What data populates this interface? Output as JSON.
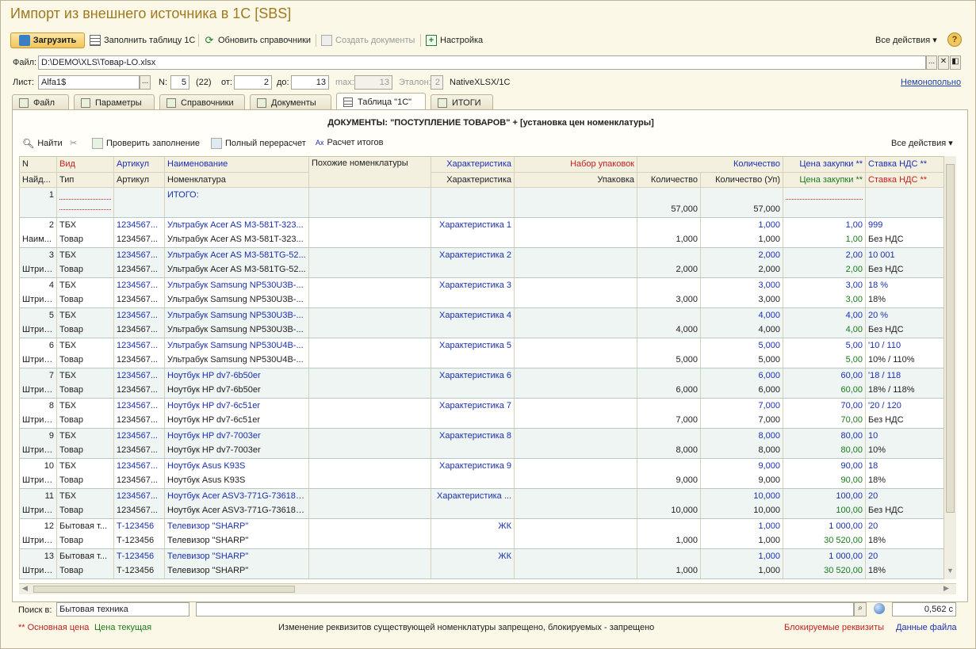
{
  "window": {
    "title": "Импорт из внешнего источника в 1С [SBS]"
  },
  "toolbar": {
    "load_label": "Загрузить",
    "fill_table_label": "Заполнить таблицу 1С",
    "refresh_refs_label": "Обновить справочники",
    "create_docs_label": "Создать документы",
    "settings_label": "Настройка",
    "all_actions_label": "Все действия ▾",
    "help_label": "?"
  },
  "file": {
    "label": "Файл:",
    "value": "D:\\DEMO\\XLS\\Товар-LO.xlsx",
    "btn_browse": "...",
    "btn_clear": "✕",
    "btn_open": "◧"
  },
  "params": {
    "sheet_label": "Лист:",
    "sheet_value": "Alfa1$",
    "sheet_btn": "...",
    "num_label": "N:",
    "num_value": "5",
    "num_total": "(22)",
    "from_label": "от:",
    "from_value": "2",
    "to_label": "до:",
    "to_value": "13",
    "max_label": "max:",
    "max_value": "13",
    "etalon_label": "Эталон:",
    "etalon_value": "2",
    "format_label": "NativeXLSX/1C",
    "mode_link": "Немонопольно"
  },
  "tabs": [
    {
      "label": "Файл"
    },
    {
      "label": "Параметры"
    },
    {
      "label": "Справочники"
    },
    {
      "label": "Документы"
    },
    {
      "label": "Таблица \"1С\""
    },
    {
      "label": "ИТОГИ"
    }
  ],
  "panel": {
    "title": "ДОКУМЕНТЫ: \"ПОСТУПЛЕНИЕ ТОВАРОВ\" + [установка цен номенклатуры]",
    "find_label": "Найти",
    "check_label": "Проверить заполнение",
    "recalc_label": "Полный перерасчет",
    "totals_label": "Расчет итогов",
    "all_actions_label": "Все действия ▾"
  },
  "table": {
    "header1": [
      "N",
      "Вид",
      "Артикул",
      "Наименование",
      "Похожие номенклатуры",
      "Характеристика",
      "Набор упаковок",
      "",
      "Количество",
      "Цена закупки **",
      "Ставка НДС **"
    ],
    "header2": [
      "Найд...",
      "Тип",
      "Артикул",
      "Номенклатура",
      "",
      "Характеристика",
      "Упаковка",
      "Количество",
      "Количество (Уп)",
      "Цена закупки **",
      "Ставка НДС **"
    ],
    "total_row": {
      "n": "1",
      "name": "ИТОГО:",
      "qty": "57,000",
      "qty_up": "57,000"
    },
    "rows": [
      {
        "n": "2",
        "n2": "Наим...",
        "vid": "ТБХ",
        "tip": "Товар",
        "art": "1234567...",
        "art2": "1234567...",
        "name": "Ультрабук Acer AS M3-581T-323...",
        "nom": "Ультрабук Acer AS M3-581T-323...",
        "char": "Характеристика 1",
        "qty_a": "1,000",
        "qty_b": "1,000",
        "qty_c": "1,000",
        "price_a": "1,00",
        "price_b": "1,00",
        "vat_a": "999",
        "vat_b": "Без НДС"
      },
      {
        "n": "3",
        "n2": "Штрих...",
        "vid": "ТБХ",
        "tip": "Товар",
        "art": "1234567...",
        "art2": "1234567...",
        "name": "Ультрабук Acer AS M3-581TG-52...",
        "nom": "Ультрабук Acer AS M3-581TG-52...",
        "char": "Характеристика 2",
        "qty_a": "2,000",
        "qty_b": "2,000",
        "qty_c": "2,000",
        "price_a": "2,00",
        "price_b": "2,00",
        "vat_a": "10 001",
        "vat_b": "Без НДС"
      },
      {
        "n": "4",
        "n2": "Штрих...",
        "vid": "ТБХ",
        "tip": "Товар",
        "art": "1234567...",
        "art2": "1234567...",
        "name": "Ультрабук Samsung NP530U3B-...",
        "nom": "Ультрабук Samsung NP530U3B-...",
        "char": "Характеристика 3",
        "qty_a": "3,000",
        "qty_b": "3,000",
        "qty_c": "3,000",
        "price_a": "3,00",
        "price_b": "3,00",
        "vat_a": "18 %",
        "vat_b": "18%"
      },
      {
        "n": "5",
        "n2": "Штрих...",
        "vid": "ТБХ",
        "tip": "Товар",
        "art": "1234567...",
        "art2": "1234567...",
        "name": "Ультрабук Samsung NP530U3B-...",
        "nom": "Ультрабук Samsung NP530U3B-...",
        "char": "Характеристика 4",
        "qty_a": "4,000",
        "qty_b": "4,000",
        "qty_c": "4,000",
        "price_a": "4,00",
        "price_b": "4,00",
        "vat_a": "20 %",
        "vat_b": "Без НДС"
      },
      {
        "n": "6",
        "n2": "Штрих...",
        "vid": "ТБХ",
        "tip": "Товар",
        "art": "1234567...",
        "art2": "1234567...",
        "name": "Ультрабук Samsung NP530U4B-...",
        "nom": "Ультрабук Samsung NP530U4B-...",
        "char": "Характеристика 5",
        "qty_a": "5,000",
        "qty_b": "5,000",
        "qty_c": "5,000",
        "price_a": "5,00",
        "price_b": "5,00",
        "vat_a": "'10 / 110",
        "vat_b": "10% / 110%"
      },
      {
        "n": "7",
        "n2": "Штрих...",
        "vid": "ТБХ",
        "tip": "Товар",
        "art": "1234567...",
        "art2": "1234567...",
        "name": "Ноутбук HP dv7-6b50er",
        "nom": "Ноутбук HP dv7-6b50er",
        "char": "Характеристика 6",
        "qty_a": "6,000",
        "qty_b": "6,000",
        "qty_c": "6,000",
        "price_a": "60,00",
        "price_b": "60,00",
        "vat_a": "'18 / 118",
        "vat_b": "18% / 118%"
      },
      {
        "n": "8",
        "n2": "Штрих...",
        "vid": "ТБХ",
        "tip": "Товар",
        "art": "1234567...",
        "art2": "1234567...",
        "name": "Ноутбук HP dv7-6c51er",
        "nom": "Ноутбук HP dv7-6c51er",
        "char": "Характеристика 7",
        "qty_a": "7,000",
        "qty_b": "7,000",
        "qty_c": "7,000",
        "price_a": "70,00",
        "price_b": "70,00",
        "vat_a": "'20 / 120",
        "vat_b": "Без НДС"
      },
      {
        "n": "9",
        "n2": "Штрих...",
        "vid": "ТБХ",
        "tip": "Товар",
        "art": "1234567...",
        "art2": "1234567...",
        "name": "Ноутбук HP dv7-7003er",
        "nom": "Ноутбук HP dv7-7003er",
        "char": "Характеристика 8",
        "qty_a": "8,000",
        "qty_b": "8,000",
        "qty_c": "8,000",
        "price_a": "80,00",
        "price_b": "80,00",
        "vat_a": "10",
        "vat_b": "10%"
      },
      {
        "n": "10",
        "n2": "Штрих...",
        "vid": "ТБХ",
        "tip": "Товар",
        "art": "1234567...",
        "art2": "1234567...",
        "name": "Ноутбук Asus K93S",
        "nom": "Ноутбук Asus K93S",
        "char": "Характеристика 9",
        "qty_a": "9,000",
        "qty_b": "9,000",
        "qty_c": "9,000",
        "price_a": "90,00",
        "price_b": "90,00",
        "vat_a": "18",
        "vat_b": "18%"
      },
      {
        "n": "11",
        "n2": "Штрих...",
        "vid": "ТБХ",
        "tip": "Товар",
        "art": "1234567...",
        "art2": "1234567...",
        "name": "Ноутбук Acer ASV3-771G-73618G...",
        "nom": "Ноутбук Acer ASV3-771G-73618G...",
        "char": "Характеристика ...",
        "qty_a": "10,000",
        "qty_b": "10,000",
        "qty_c": "10,000",
        "price_a": "100,00",
        "price_b": "100,00",
        "vat_a": "20",
        "vat_b": "Без НДС"
      },
      {
        "n": "12",
        "n2": "Штрих...",
        "vid": "Бытовая т...",
        "tip": "Товар",
        "art": "Т-123456",
        "art2": "Т-123456",
        "name": "Телевизор \"SHARP\"",
        "nom": "Телевизор \"SHARP\"",
        "char": "ЖК",
        "qty_a": "1,000",
        "qty_b": "1,000",
        "qty_c": "1,000",
        "price_a": "1 000,00",
        "price_b": "30 520,00",
        "vat_a": "20",
        "vat_b": "18%"
      },
      {
        "n": "13",
        "n2": "Штрих...",
        "vid": "Бытовая т...",
        "tip": "Товар",
        "art": "Т-123456",
        "art2": "Т-123456",
        "name": "Телевизор \"SHARP\"",
        "nom": "Телевизор \"SHARP\"",
        "char": "ЖК",
        "qty_a": "1,000",
        "qty_b": "1,000",
        "qty_c": "1,000",
        "price_a": "1 000,00",
        "price_b": "30 520,00",
        "vat_a": "20",
        "vat_b": "18%"
      }
    ]
  },
  "search": {
    "label": "Поиск в:",
    "scope": "Бытовая техника",
    "query": "",
    "value_right": "0,562 с"
  },
  "footer": {
    "legend_main": "** Основная цена",
    "legend_current": "Цена текущая",
    "status": "Изменение реквизитов существующей номенклатуры запрещено, блокируемых - запрещено",
    "blocked_link": "Блокируемые реквизиты",
    "file_data_link": "Данные файла"
  }
}
